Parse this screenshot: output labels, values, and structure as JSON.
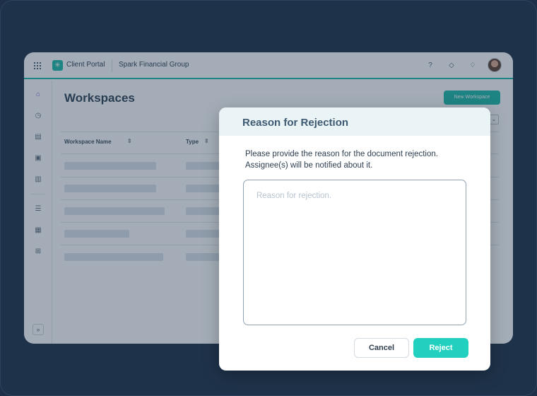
{
  "app": {
    "brand": "Client Portal",
    "org": "Spark Financial Group",
    "topbar_icons": [
      "help-icon",
      "graduation-cap-icon",
      "bell-icon"
    ],
    "accent_color": "#19b8a5"
  },
  "sidebar": {
    "items": [
      "home-icon",
      "clock-icon",
      "document-icon",
      "clipboard-icon",
      "trash-icon",
      "sliders-icon",
      "contact-card-icon",
      "apps-icon"
    ],
    "expand_label": "»"
  },
  "main": {
    "title": "Workspaces",
    "new_button": "New Workspace",
    "columns": [
      "Workspace Name",
      "Type"
    ]
  },
  "modal": {
    "title": "Reason for Rejection",
    "description": "Please provide the reason for the document rejection. Assignee(s) will be notified about it.",
    "placeholder": "Reason for rejection.",
    "value": "",
    "cancel_label": "Cancel",
    "reject_label": "Reject",
    "reject_color": "#22d0bf"
  }
}
